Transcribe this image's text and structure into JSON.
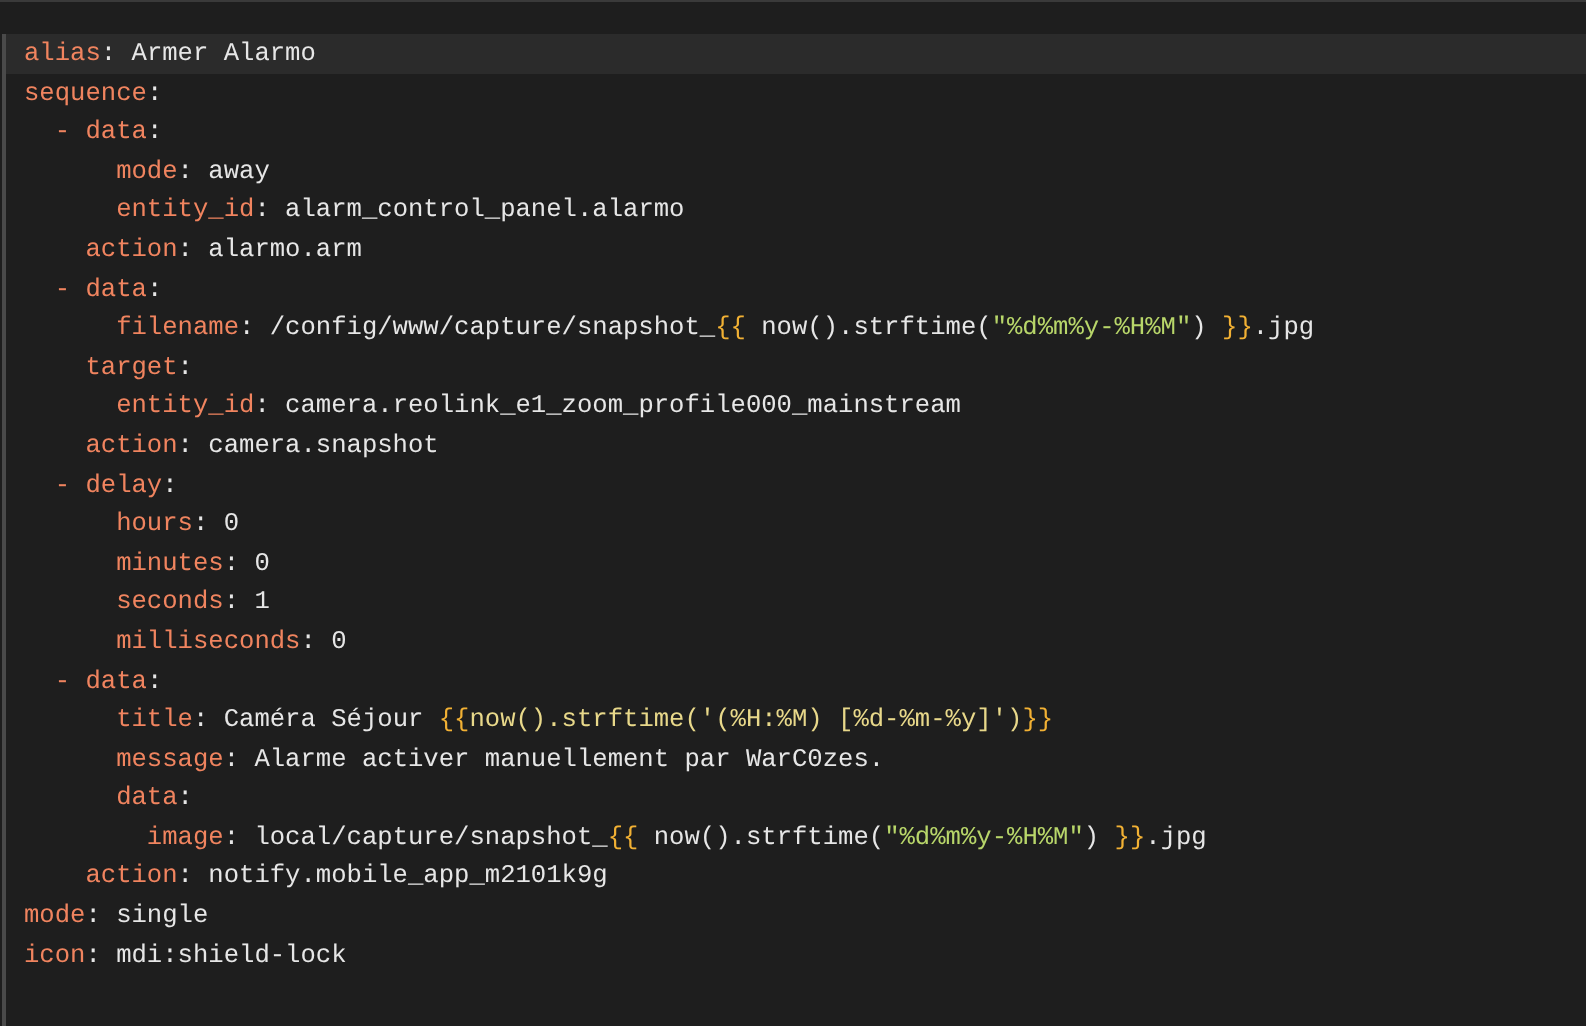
{
  "editor": {
    "lines": [
      {
        "selected": true,
        "tokens": [
          {
            "kind": "key",
            "text": "alias"
          },
          {
            "kind": "plain",
            "text": ": Armer Alarmo"
          }
        ]
      },
      {
        "selected": false,
        "tokens": [
          {
            "kind": "key",
            "text": "sequence"
          },
          {
            "kind": "plain",
            "text": ":"
          }
        ]
      },
      {
        "selected": false,
        "tokens": [
          {
            "kind": "key",
            "text": "  - data"
          },
          {
            "kind": "plain",
            "text": ":"
          }
        ]
      },
      {
        "selected": false,
        "tokens": [
          {
            "kind": "key",
            "text": "      mode"
          },
          {
            "kind": "plain",
            "text": ": away"
          }
        ]
      },
      {
        "selected": false,
        "tokens": [
          {
            "kind": "key",
            "text": "      entity_id"
          },
          {
            "kind": "plain",
            "text": ": alarm_control_panel.alarmo"
          }
        ]
      },
      {
        "selected": false,
        "tokens": [
          {
            "kind": "key",
            "text": "    action"
          },
          {
            "kind": "plain",
            "text": ": alarmo.arm"
          }
        ]
      },
      {
        "selected": false,
        "tokens": [
          {
            "kind": "key",
            "text": "  - data"
          },
          {
            "kind": "plain",
            "text": ":"
          }
        ]
      },
      {
        "selected": false,
        "tokens": [
          {
            "kind": "key",
            "text": "      filename"
          },
          {
            "kind": "plain",
            "text": ": /config/www/capture/snapshot_"
          },
          {
            "kind": "brace",
            "text": "{{"
          },
          {
            "kind": "plain",
            "text": " now().strftime("
          },
          {
            "kind": "string",
            "text": "\"%d%m%y-%H%M\""
          },
          {
            "kind": "plain",
            "text": ") "
          },
          {
            "kind": "brace",
            "text": "}}"
          },
          {
            "kind": "plain",
            "text": ".jpg"
          }
        ]
      },
      {
        "selected": false,
        "tokens": [
          {
            "kind": "key",
            "text": "    target"
          },
          {
            "kind": "plain",
            "text": ":"
          }
        ]
      },
      {
        "selected": false,
        "tokens": [
          {
            "kind": "key",
            "text": "      entity_id"
          },
          {
            "kind": "plain",
            "text": ": camera.reolink_e1_zoom_profile000_mainstream"
          }
        ]
      },
      {
        "selected": false,
        "tokens": [
          {
            "kind": "key",
            "text": "    action"
          },
          {
            "kind": "plain",
            "text": ": camera.snapshot"
          }
        ]
      },
      {
        "selected": false,
        "tokens": [
          {
            "kind": "key",
            "text": "  - delay"
          },
          {
            "kind": "plain",
            "text": ":"
          }
        ]
      },
      {
        "selected": false,
        "tokens": [
          {
            "kind": "key",
            "text": "      hours"
          },
          {
            "kind": "plain",
            "text": ": 0"
          }
        ]
      },
      {
        "selected": false,
        "tokens": [
          {
            "kind": "key",
            "text": "      minutes"
          },
          {
            "kind": "plain",
            "text": ": 0"
          }
        ]
      },
      {
        "selected": false,
        "tokens": [
          {
            "kind": "key",
            "text": "      seconds"
          },
          {
            "kind": "plain",
            "text": ": 1"
          }
        ]
      },
      {
        "selected": false,
        "tokens": [
          {
            "kind": "key",
            "text": "      milliseconds"
          },
          {
            "kind": "plain",
            "text": ": 0"
          }
        ]
      },
      {
        "selected": false,
        "tokens": [
          {
            "kind": "key",
            "text": "  - data"
          },
          {
            "kind": "plain",
            "text": ":"
          }
        ]
      },
      {
        "selected": false,
        "tokens": [
          {
            "kind": "key",
            "text": "      title"
          },
          {
            "kind": "plain",
            "text": ": Caméra Séjour "
          },
          {
            "kind": "brace",
            "text": "{{"
          },
          {
            "kind": "template",
            "text": "now().strftime('(%H:%M) [%d-%m-%y]')"
          },
          {
            "kind": "brace",
            "text": "}}"
          }
        ]
      },
      {
        "selected": false,
        "tokens": [
          {
            "kind": "key",
            "text": "      message"
          },
          {
            "kind": "plain",
            "text": ": Alarme activer manuellement par WarC0zes."
          }
        ]
      },
      {
        "selected": false,
        "tokens": [
          {
            "kind": "key",
            "text": "      data"
          },
          {
            "kind": "plain",
            "text": ":"
          }
        ]
      },
      {
        "selected": false,
        "tokens": [
          {
            "kind": "key",
            "text": "        image"
          },
          {
            "kind": "plain",
            "text": ": local/capture/snapshot_"
          },
          {
            "kind": "brace",
            "text": "{{"
          },
          {
            "kind": "plain",
            "text": " now().strftime("
          },
          {
            "kind": "string",
            "text": "\"%d%m%y-%H%M\""
          },
          {
            "kind": "plain",
            "text": ") "
          },
          {
            "kind": "brace",
            "text": "}}"
          },
          {
            "kind": "plain",
            "text": ".jpg"
          }
        ]
      },
      {
        "selected": false,
        "tokens": [
          {
            "kind": "key",
            "text": "    action"
          },
          {
            "kind": "plain",
            "text": ": notify.mobile_app_m2101k9g"
          }
        ]
      },
      {
        "selected": false,
        "tokens": [
          {
            "kind": "key",
            "text": "mode"
          },
          {
            "kind": "plain",
            "text": ": single"
          }
        ]
      },
      {
        "selected": false,
        "tokens": [
          {
            "kind": "key",
            "text": "icon"
          },
          {
            "kind": "plain",
            "text": ": mdi:shield-lock"
          }
        ]
      }
    ]
  }
}
